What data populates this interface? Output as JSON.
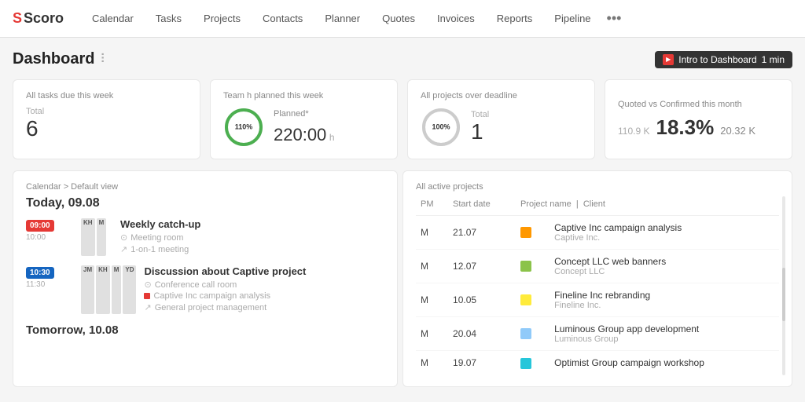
{
  "nav": {
    "logo": "Scoro",
    "items": [
      {
        "label": "Calendar",
        "active": false
      },
      {
        "label": "Tasks",
        "active": false
      },
      {
        "label": "Projects",
        "active": false
      },
      {
        "label": "Contacts",
        "active": false
      },
      {
        "label": "Planner",
        "active": false
      },
      {
        "label": "Quotes",
        "active": false
      },
      {
        "label": "Invoices",
        "active": false
      },
      {
        "label": "Reports",
        "active": false
      },
      {
        "label": "Pipeline",
        "active": false
      }
    ],
    "more": "•••"
  },
  "dashboard": {
    "title": "Dashboard",
    "intro_label": "Intro to Dashboard",
    "intro_time": "1 min"
  },
  "stat_cards": {
    "tasks": {
      "label": "All tasks due this week",
      "sub": "Total",
      "value": "6"
    },
    "team": {
      "label": "Team h planned this week",
      "planned_label": "Planned*",
      "planned_value": "220:00",
      "planned_unit": "h",
      "circle_pct": "110%",
      "stroke_pct": 100
    },
    "projects": {
      "label": "All projects over deadline",
      "sub": "Total",
      "value": "1",
      "circle_pct": "100%",
      "stroke_pct": 100
    },
    "quoted": {
      "label": "Quoted vs Confirmed this month",
      "left_value": "110.9 K",
      "pct": "18.3%",
      "right_value": "20.32 K"
    }
  },
  "calendar": {
    "breadcrumb": "Calendar > Default view",
    "date": "Today, 09.08",
    "events": [
      {
        "time_start": "09:00",
        "time_end": "10:00",
        "avatars": [
          "KH",
          "M"
        ],
        "title": "Weekly catch-up",
        "location": "Meeting room",
        "link": "1-on-1 meeting",
        "tag_color": null
      },
      {
        "time_start": "10:30",
        "time_end": "11:30",
        "avatars": [
          "JM",
          "KH",
          "M",
          "YD"
        ],
        "title": "Discussion about Captive project",
        "location": "Conference call room",
        "tag": "Captive Inc campaign analysis",
        "link": "General project management",
        "tag_color": "#e53935"
      }
    ],
    "tomorrow": "Tomorrow, 10.08"
  },
  "projects": {
    "label": "All active projects",
    "columns": [
      "PM",
      "Start date",
      "Project name",
      "Client"
    ],
    "rows": [
      {
        "pm": "M",
        "start": "21.07",
        "color": "#ff9800",
        "name": "Captive Inc campaign analysis",
        "client": "Captive Inc."
      },
      {
        "pm": "M",
        "start": "12.07",
        "color": "#8bc34a",
        "name": "Concept LLC web banners",
        "client": "Concept LLC"
      },
      {
        "pm": "M",
        "start": "10.05",
        "color": "#ffeb3b",
        "name": "Fineline Inc rebranding",
        "client": "Fineline Inc."
      },
      {
        "pm": "M",
        "start": "20.04",
        "color": "#90caf9",
        "name": "Luminous Group app development",
        "client": "Luminous Group"
      },
      {
        "pm": "M",
        "start": "19.07",
        "color": "#26c6da",
        "name": "Optimist Group campaign workshop",
        "client": ""
      }
    ]
  }
}
